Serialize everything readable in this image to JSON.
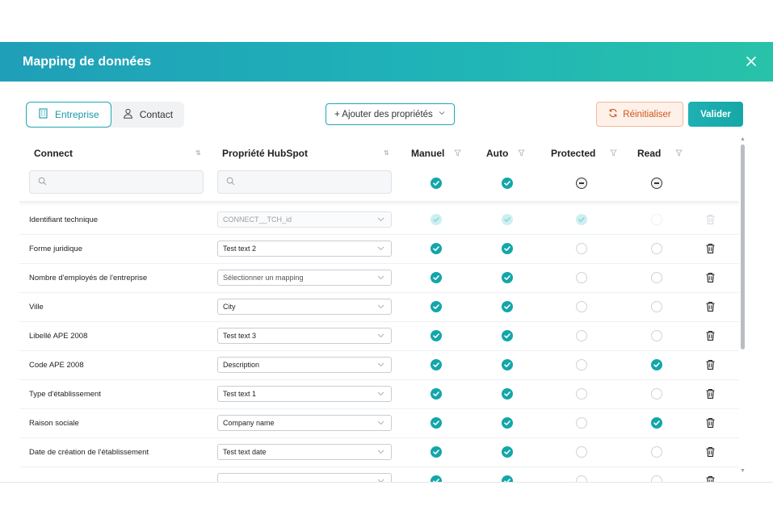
{
  "modal": {
    "title": "Mapping de données"
  },
  "tabs": [
    {
      "label": "Entreprise",
      "icon": "building-icon",
      "active": true
    },
    {
      "label": "Contact",
      "icon": "user-icon",
      "active": false
    }
  ],
  "toolbar": {
    "add_properties_label": "+ Ajouter des propriétés",
    "reset_label": "Réinitialiser",
    "validate_label": "Valider"
  },
  "columns": {
    "connect": "Connect",
    "hubspot": "Propriété HubSpot",
    "manuel": "Manuel",
    "auto": "Auto",
    "protected": "Protected",
    "read": "Read"
  },
  "header_checks": {
    "manuel": "checked",
    "auto": "checked",
    "protected": "indeterminate",
    "read": "indeterminate"
  },
  "rows": [
    {
      "label": "Identifiant technique",
      "hubspot": "CONNECT__TCH_id",
      "manuel": "disabled",
      "auto": "disabled",
      "protected": "disabled",
      "read": "blank",
      "select_state": "disabled"
    },
    {
      "label": "Forme juridique",
      "hubspot": "Test text 2",
      "manuel": "checked",
      "auto": "checked",
      "protected": "unchecked",
      "read": "unchecked",
      "select_state": "value"
    },
    {
      "label": "Nombre d'employés de l'entreprise",
      "hubspot": "Sélectionner un mapping",
      "manuel": "checked",
      "auto": "checked",
      "protected": "unchecked",
      "read": "unchecked",
      "select_state": "placeholder"
    },
    {
      "label": "Ville",
      "hubspot": "City",
      "manuel": "checked",
      "auto": "checked",
      "protected": "unchecked",
      "read": "unchecked",
      "select_state": "value"
    },
    {
      "label": "Libellé APE 2008",
      "hubspot": "Test text 3",
      "manuel": "checked",
      "auto": "checked",
      "protected": "unchecked",
      "read": "unchecked",
      "select_state": "value"
    },
    {
      "label": "Code APE 2008",
      "hubspot": "Description",
      "manuel": "checked",
      "auto": "checked",
      "protected": "unchecked",
      "read": "checked",
      "select_state": "value"
    },
    {
      "label": "Type d'établissement",
      "hubspot": "Test text 1",
      "manuel": "checked",
      "auto": "checked",
      "protected": "unchecked",
      "read": "unchecked",
      "select_state": "value"
    },
    {
      "label": "Raison sociale",
      "hubspot": "Company name",
      "manuel": "checked",
      "auto": "checked",
      "protected": "unchecked",
      "read": "checked",
      "select_state": "value"
    },
    {
      "label": "Date de création de l'établissement",
      "hubspot": "Test text date",
      "manuel": "checked",
      "auto": "checked",
      "protected": "unchecked",
      "read": "unchecked",
      "select_state": "value"
    },
    {
      "label": "",
      "hubspot": "",
      "manuel": "checked",
      "auto": "checked",
      "protected": "unchecked",
      "read": "unchecked",
      "select_state": "value"
    }
  ]
}
